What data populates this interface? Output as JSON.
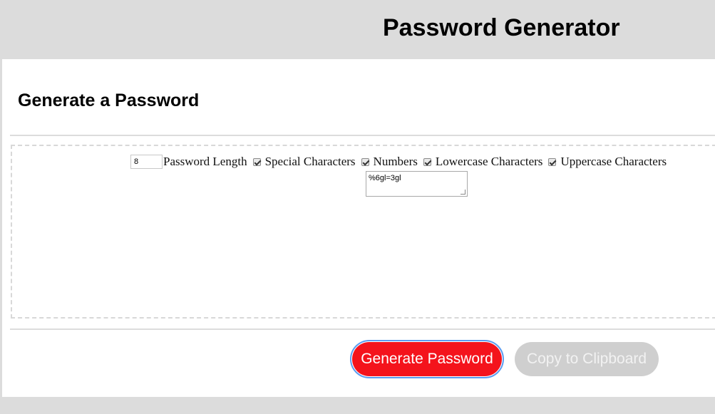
{
  "header": {
    "title": "Password Generator"
  },
  "card": {
    "heading": "Generate a Password",
    "length_value": "8",
    "length_label": "Password Length",
    "options": [
      {
        "label": "Special Characters",
        "checked": true
      },
      {
        "label": "Numbers",
        "checked": true
      },
      {
        "label": "Lowercase Characters",
        "checked": true
      },
      {
        "label": "Uppercase Characters",
        "checked": true
      }
    ],
    "password_output": "%6gl=3gl"
  },
  "footer": {
    "generate_label": "Generate Password",
    "copy_label": "Copy to Clipboard"
  },
  "colors": {
    "generate_button": "#f4131c",
    "copy_button_disabled": "#cfcfcf",
    "focus_ring": "#5b9cf0",
    "page_background": "#dcdcdc"
  }
}
